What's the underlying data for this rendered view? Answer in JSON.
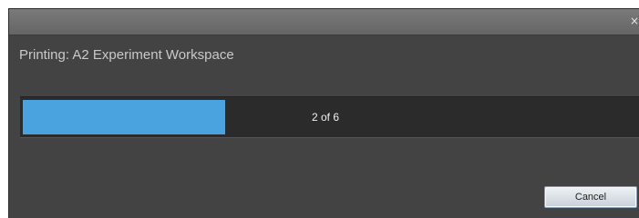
{
  "dialog": {
    "title": "Printing: A2 Experiment Workspace",
    "close_icon": "close-icon",
    "close_glyph": "×"
  },
  "progress": {
    "current": 2,
    "total": 6,
    "text": "2 of 6",
    "fraction": 0.33,
    "fill_color": "#4aa3de"
  },
  "buttons": {
    "cancel_label": "Cancel"
  }
}
